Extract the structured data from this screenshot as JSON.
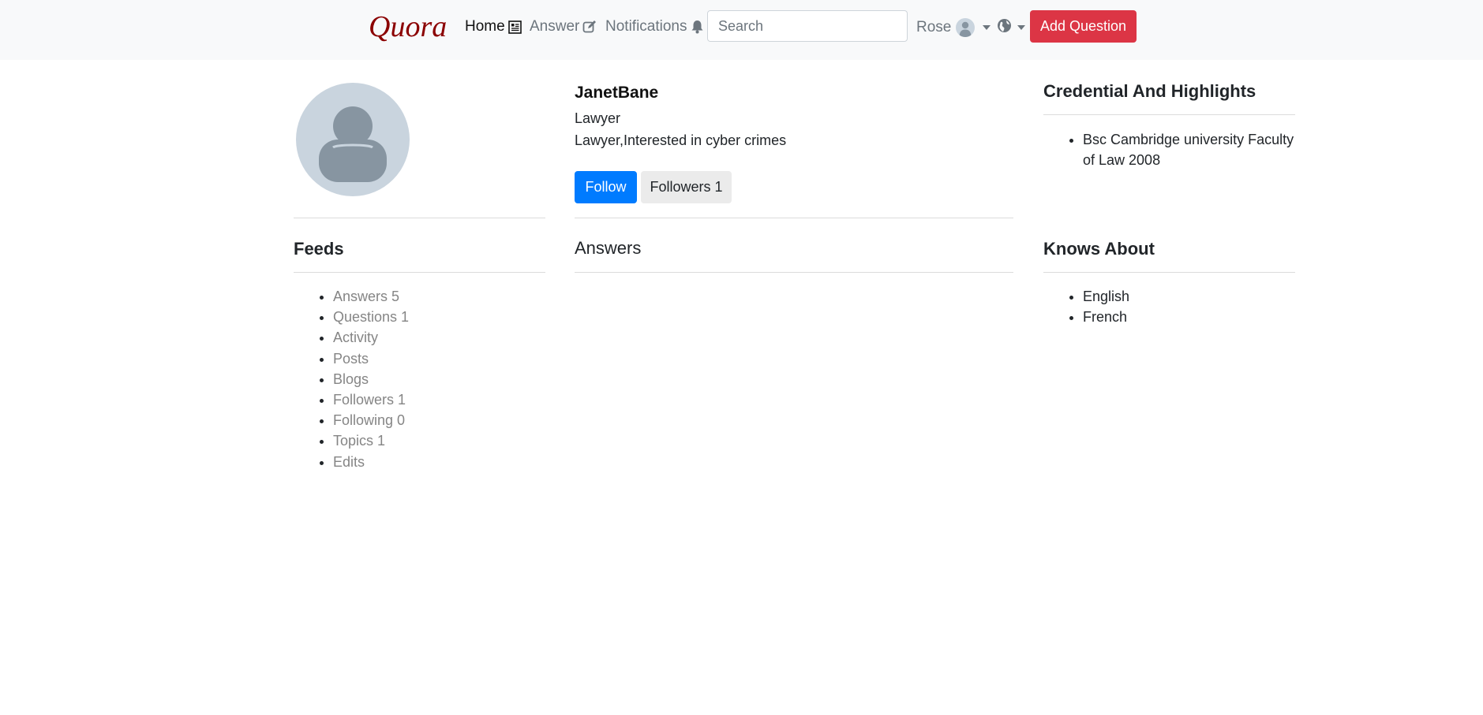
{
  "nav": {
    "brand": "Quora",
    "home_label": "Home",
    "answer_label": "Answer",
    "notifications_label": "Notifications",
    "search_placeholder": "Search",
    "user_name": "Rose",
    "add_question_label": "Add Question"
  },
  "profile": {
    "name": "JanetBane",
    "title": "Lawyer",
    "bio": "Lawyer,Interested in cyber crimes",
    "follow_label": "Follow",
    "followers_label": "Followers 1"
  },
  "credentials": {
    "heading": "Credential And Highlights",
    "items": [
      "Bsc Cambridge university Faculty of Law 2008"
    ]
  },
  "feeds": {
    "heading": "Feeds",
    "items": [
      "Answers 5",
      "Questions 1",
      "Activity",
      "Posts",
      "Blogs",
      "Followers 1",
      "Following 0",
      "Topics 1",
      "Edits"
    ]
  },
  "answers": {
    "heading": "Answers"
  },
  "knows_about": {
    "heading": "Knows About",
    "items": [
      "English",
      "French"
    ]
  },
  "icons": {
    "home": "newspaper-icon",
    "answer": "edit-icon",
    "notifications": "bell-icon",
    "user": "avatar",
    "language": "globe-icon"
  },
  "colors": {
    "brand": "#8b0000",
    "follow_button": "#007bff",
    "add_question_button": "#dc3545",
    "navbar_bg": "#f8f9fa"
  }
}
